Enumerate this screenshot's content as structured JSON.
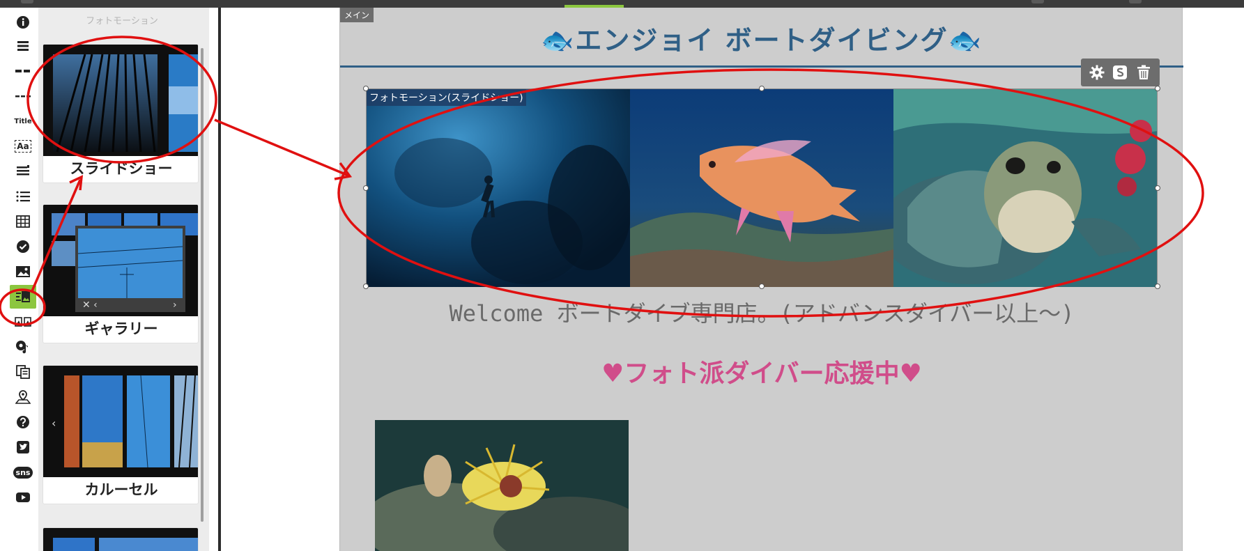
{
  "panel": {
    "title": "フォトモーション",
    "cards": [
      {
        "label": "スライドショー"
      },
      {
        "label": "ギャラリー"
      },
      {
        "label": "カルーセル"
      }
    ]
  },
  "rail": {
    "items": [
      {
        "name": "info-icon"
      },
      {
        "name": "lines-icon"
      },
      {
        "name": "dash-divider-icon"
      },
      {
        "name": "dotted-divider-icon"
      },
      {
        "name": "title-icon",
        "text": "Title"
      },
      {
        "name": "text-icon",
        "text": "Aa"
      },
      {
        "name": "paragraph-icon"
      },
      {
        "name": "list-icon"
      },
      {
        "name": "table-icon"
      },
      {
        "name": "check-icon"
      },
      {
        "name": "image-icon"
      },
      {
        "name": "photomotion-icon"
      },
      {
        "name": "two-image-icon"
      },
      {
        "name": "audio-icon"
      },
      {
        "name": "copy-icon"
      },
      {
        "name": "map-pin-icon"
      },
      {
        "name": "help-icon"
      },
      {
        "name": "twitter-icon"
      },
      {
        "name": "sns-icon",
        "text": "sns"
      },
      {
        "name": "youtube-icon"
      }
    ]
  },
  "canvas": {
    "main_tag": "メイン",
    "site_title": "エンジョイ ボートダイビング",
    "slideshow_tag": "フォトモーション(スライドショー)",
    "welcome_text": "Welcome ボートダイブ専門店。(アドバンスダイバー以上～)",
    "photo_heading": "フォト派ダイバー応援中"
  },
  "colors": {
    "accent": "#8cc63f",
    "title": "#2f5f86",
    "heading_pink": "#d04d8a",
    "annotation": "#e01010"
  }
}
